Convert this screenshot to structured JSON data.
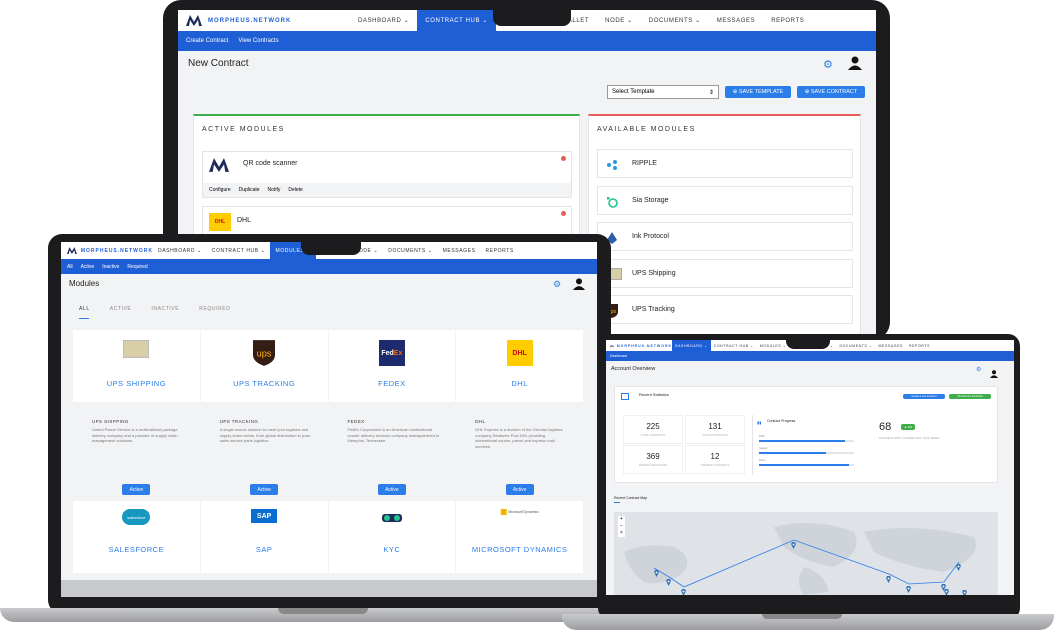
{
  "brand": "MORPHEUS.NETWORK",
  "main_laptop": {
    "nav": [
      "DASHBOARD ⌄",
      "CONTRACT HUB ⌄",
      "MODULES ⌄",
      "WALLET",
      "NODE ⌄",
      "DOCUMENTS ⌄",
      "MESSAGES",
      "REPORTS"
    ],
    "active_nav_index": 1,
    "subnav": [
      "Create Contract",
      "View Contracts"
    ],
    "page_title": "New Contract",
    "select_template": "Select Template",
    "save_template": "SAVE TEMPLATE",
    "save_contract": "SAVE CONTRACT",
    "active_modules_title": "ACTIVE MODULES",
    "available_modules_title": "AVAILABLE MODULES",
    "active_modules": [
      {
        "name": "QR code scanner",
        "actions": [
          "Configure",
          "Duplicate",
          "Notify",
          "Delete"
        ]
      },
      {
        "name": "DHL"
      }
    ],
    "available_modules": [
      "RIPPLE",
      "Sia Storage",
      "Ink Protocol",
      "UPS Shipping",
      "UPS Tracking"
    ]
  },
  "left_laptop": {
    "nav": [
      "DASHBOARD ⌄",
      "CONTRACT HUB ⌄",
      "MODULES ⌄",
      "WALLET",
      "NODE ⌄",
      "DOCUMENTS ⌄",
      "MESSAGES",
      "REPORTS"
    ],
    "active_nav_index": 2,
    "subnav": [
      "All",
      "Active",
      "Inactive",
      "Required"
    ],
    "page_title": "Modules",
    "tabs": [
      "ALL",
      "ACTIVE",
      "INACTIVE",
      "REQUIRED"
    ],
    "modules": [
      {
        "title": "UPS SHIPPING",
        "logo": "ups-shipping-logo",
        "desc_title": "UPS SHIPPING",
        "desc": "United Parcel Service is a multinational package delivery company and a provider of supply chain management solutions.",
        "status": "Active"
      },
      {
        "title": "UPS TRACKING",
        "logo": "ups-logo",
        "desc_title": "UPS TRACKING",
        "desc": "A single source solution to meet your logistics and supply chain needs, from global distribution to post-sales service parts logistics.",
        "status": "Active"
      },
      {
        "title": "FEDEX",
        "logo": "fedex-logo",
        "desc_title": "FEDEX",
        "desc": "FedEx Corporation is an American multinational courier delivery services company headquartered in Memphis, Tennessee.",
        "status": "Active"
      },
      {
        "title": "DHL",
        "logo": "dhl-logo",
        "desc_title": "DHL",
        "desc": "DHL Express is a division of the German logistics company Deutsche Post DHL providing international courier, parcel and express mail services.",
        "status": "Active"
      }
    ],
    "modules_row2": [
      {
        "title": "SALESFORCE",
        "logo": "salesforce-logo",
        "logo_text": "salesforce"
      },
      {
        "title": "SAP",
        "logo": "sap-logo",
        "logo_text": "SAP"
      },
      {
        "title": "KYC",
        "logo": "kyc-logo",
        "logo_text": ""
      },
      {
        "title": "MICROSOFT DYNAMICS",
        "logo": "microsoft-dynamics-logo",
        "logo_text": "Microsoft Dynamics"
      }
    ]
  },
  "right_laptop": {
    "nav": [
      "DASHBOARD ⌄",
      "CONTRACT HUB ⌄",
      "MODULES ⌄",
      "WALLET",
      "NODE ⌄",
      "DOCUMENTS ⌄",
      "MESSAGES",
      "REPORTS"
    ],
    "active_nav_index": 0,
    "subnav": [
      "Dashboard"
    ],
    "page_title": "Account Overview",
    "recent_stats_title": "Recent Statistics",
    "btn_create": "Create a new Contract",
    "btn_view": "View Recent Contracts",
    "stats": [
      {
        "value": "225",
        "label": "TOTAL CONTRACTS"
      },
      {
        "value": "131",
        "label": "ACTIVE CONTRACTS"
      },
      {
        "value": "369",
        "label": "PENDING SIGNATURES"
      },
      {
        "value": "12",
        "label": "OVERDUE CONTRACTS"
      }
    ],
    "contract_progress": "Contract Progress",
    "progress_bars": [
      {
        "label": "Draft",
        "value": 0.9
      },
      {
        "label": "Signed",
        "value": 0.7
      },
      {
        "label": "Done",
        "value": 0.95
      }
    ],
    "big_number": "68",
    "big_badge": "▲ 9%",
    "big_label": "CONNECTIONS CONNECTED THIS WEEK",
    "map_title": "Recent Contract Map",
    "zoom": [
      "+",
      "−",
      "×"
    ]
  },
  "colors": {
    "primary": "#1f5fd6",
    "button": "#2b7de9",
    "green": "#3fae4a",
    "red": "#e85b57",
    "navy": "#1f2a5c"
  }
}
